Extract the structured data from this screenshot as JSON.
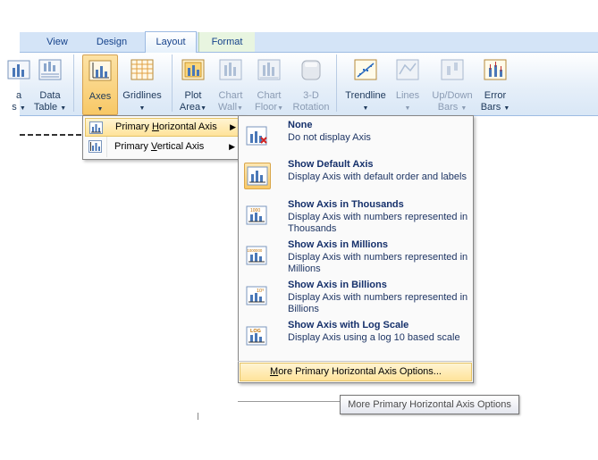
{
  "tabs": [
    {
      "label": "View",
      "active": false
    },
    {
      "label": "Design",
      "active": false
    },
    {
      "label": "Layout",
      "active": true
    },
    {
      "label": "Format",
      "active": false
    }
  ],
  "ribbon": {
    "partial_left": {
      "line1": "a",
      "line2": "s"
    },
    "data_table": {
      "line1": "Data",
      "line2": "Table"
    },
    "axes": {
      "line1": "Axes"
    },
    "gridlines": {
      "line1": "Gridlines"
    },
    "plot_area": {
      "line1": "Plot",
      "line2": "Area"
    },
    "chart_wall": {
      "line1": "Chart",
      "line2": "Wall"
    },
    "chart_floor": {
      "line1": "Chart",
      "line2": "Floor"
    },
    "rotation": {
      "line1": "3-D",
      "line2": "Rotation"
    },
    "trendline": {
      "line1": "Trendline"
    },
    "lines": {
      "line1": "Lines"
    },
    "updown_bars": {
      "line1": "Up/Down",
      "line2": "Bars"
    },
    "error_bars": {
      "line1": "Error",
      "line2": "Bars"
    }
  },
  "submenu": {
    "items": [
      {
        "pre": "Primary ",
        "key": "H",
        "post": "orizontal Axis",
        "highlighted": true
      },
      {
        "pre": "Primary ",
        "key": "V",
        "post": "ertical Axis",
        "highlighted": false
      }
    ]
  },
  "menu": {
    "items": [
      {
        "title": "None",
        "desc": "Do not display Axis",
        "icon": "axis-none-icon",
        "selected": false
      },
      {
        "title": "Show Default Axis",
        "desc": "Display Axis with default order and labels",
        "icon": "axis-default-icon",
        "selected": true
      },
      {
        "title": "Show Axis in Thousands",
        "desc": "Display Axis with numbers represented in Thousands",
        "icon": "axis-thousands-icon",
        "icon_text": "1000",
        "selected": false
      },
      {
        "title": "Show Axis in Millions",
        "desc": "Display Axis with numbers represented in Millions",
        "icon": "axis-millions-icon",
        "icon_text": "1000000",
        "selected": false
      },
      {
        "title": "Show Axis in Billions",
        "desc": "Display Axis with numbers represented in Billions",
        "icon": "axis-billions-icon",
        "icon_text": "10⁹",
        "selected": false
      },
      {
        "title": "Show Axis with Log Scale",
        "desc": "Display Axis using a log 10 based scale",
        "icon": "axis-log-icon",
        "icon_text": "LOG",
        "selected": false
      }
    ],
    "more": {
      "pre": "",
      "key": "M",
      "post": "ore Primary Horizontal Axis Options..."
    }
  },
  "tooltip": {
    "text": "More Primary Horizontal Axis Options"
  },
  "colors": {
    "accent": "#f9c864",
    "tab_text": "#15428b",
    "menu_title": "#15306b"
  }
}
